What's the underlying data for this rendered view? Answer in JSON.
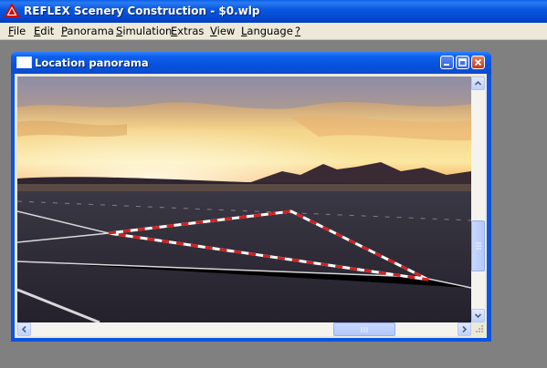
{
  "app": {
    "title": "REFLEX Scenery Construction - $0.wlp"
  },
  "menu": {
    "file": "File",
    "edit": "Edit",
    "panorama": "Panorama",
    "simulation": "Simulation",
    "extras": "Extras",
    "view": "View",
    "language": "Language",
    "help": "?"
  },
  "child_window": {
    "title": "Location panorama"
  },
  "icons": {
    "app": "reflex-warning-triangle-icon",
    "child": "window-icon",
    "minimize": "minimize-icon",
    "restore": "restore-icon",
    "close": "close-icon"
  },
  "colors": {
    "titlebar": "#0a58e0",
    "menubar": "#ece9d8",
    "mdi_background": "#808080",
    "marker_red": "#d42020",
    "marker_white": "#ffffff"
  }
}
